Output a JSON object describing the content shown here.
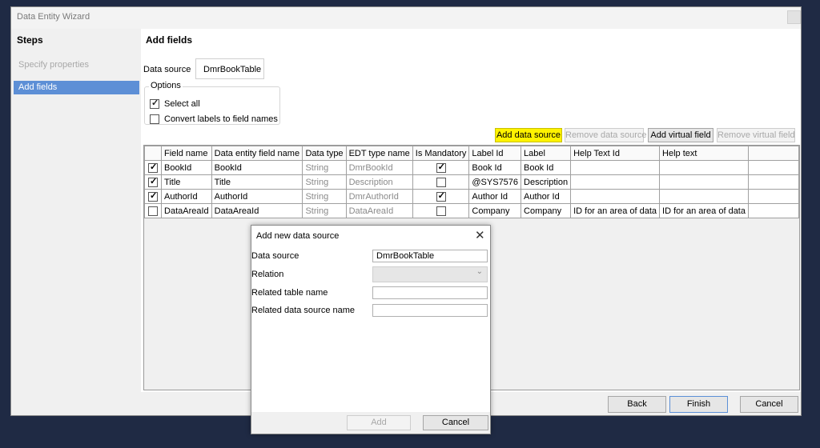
{
  "window": {
    "title": "Data Entity Wizard"
  },
  "steps": {
    "heading": "Steps",
    "items": [
      {
        "label": "Specify properties",
        "state": "inactive"
      },
      {
        "label": "Add fields",
        "state": "selected"
      }
    ]
  },
  "page": {
    "title": "Add fields",
    "data_source_label": "Data source",
    "data_source_value": "DmrBookTable",
    "options": {
      "title": "Options",
      "select_all": "Select all",
      "convert_labels": "Convert labels to field names"
    }
  },
  "toolbar": {
    "add_data_source": "Add data source",
    "remove_data_source": "Remove data source",
    "add_virtual_field": "Add virtual field",
    "remove_virtual_field": "Remove virtual field"
  },
  "table": {
    "columns": [
      "Field name",
      "Data entity field name",
      "Data type",
      "EDT type name",
      "Is Mandatory",
      "Label Id",
      "Label",
      "Help Text Id",
      "Help text"
    ],
    "rows": [
      {
        "selected": true,
        "field_name": "BookId",
        "entity_field_name": "BookId",
        "data_type": "String",
        "edt": "DmrBookId",
        "mandatory": true,
        "label_id": "Book Id",
        "label": "Book Id",
        "help_text_id": "",
        "help_text": ""
      },
      {
        "selected": true,
        "field_name": "Title",
        "entity_field_name": "Title",
        "data_type": "String",
        "edt": "Description",
        "mandatory": false,
        "label_id": "@SYS7576",
        "label": "Description",
        "help_text_id": "",
        "help_text": ""
      },
      {
        "selected": true,
        "field_name": "AuthorId",
        "entity_field_name": "AuthorId",
        "data_type": "String",
        "edt": "DmrAuthorId",
        "mandatory": true,
        "label_id": "Author Id",
        "label": "Author Id",
        "help_text_id": "",
        "help_text": ""
      },
      {
        "selected": false,
        "field_name": "DataAreaId",
        "entity_field_name": "DataAreaId",
        "data_type": "String",
        "edt": "DataAreaId",
        "mandatory": false,
        "label_id": "Company",
        "label": "Company",
        "help_text_id": "ID for an area of data",
        "help_text": "ID for an area of data"
      }
    ]
  },
  "footer": {
    "back": "Back",
    "finish": "Finish",
    "cancel": "Cancel"
  },
  "dialog": {
    "title": "Add new data source",
    "close_icon": "close-icon",
    "data_source_label": "Data source",
    "data_source_value": "DmrBookTable",
    "relation_label": "Relation",
    "relation_value": "",
    "related_table_label": "Related table name",
    "related_table_value": "",
    "related_ds_label": "Related data source name",
    "related_ds_value": "",
    "add": "Add",
    "cancel": "Cancel"
  },
  "colors": {
    "background": "#1f2a44",
    "selected_step": "#5d8fd6",
    "highlight": "#fff200"
  }
}
